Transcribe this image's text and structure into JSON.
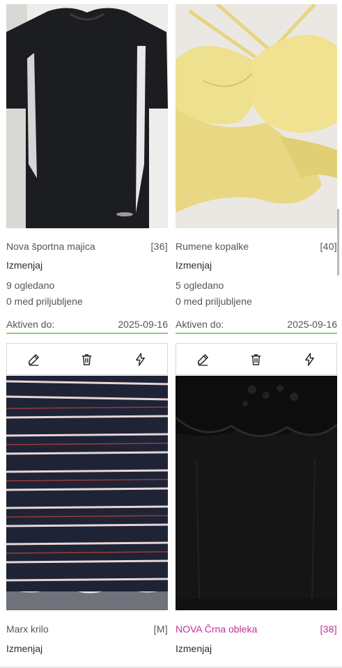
{
  "listings": [
    {
      "title": "Nova športna majica",
      "size": "[36]",
      "edit_label": "Izmenjaj",
      "views": "9 ogledano",
      "favorites": "0 med priljubljene",
      "active_label": "Aktiven do:",
      "active_date": "2025-09-16",
      "highlight": false,
      "image": "black-sport-shirt"
    },
    {
      "title": "Rumene kopalke",
      "size": "[40]",
      "edit_label": "Izmenjaj",
      "views": "5 ogledano",
      "favorites": "0 med priljubljene",
      "active_label": "Aktiven do:",
      "active_date": "2025-09-16",
      "highlight": false,
      "image": "yellow-swimsuit"
    },
    {
      "title": "Marx krilo",
      "size": "[M]",
      "edit_label": "Izmenjaj",
      "highlight": false,
      "image": "striped-skirt"
    },
    {
      "title": "NOVA Črna obleka",
      "size": "[38]",
      "edit_label": "Izmenjaj",
      "highlight": true,
      "highlight_color": "#c0309a",
      "image": "black-dress"
    }
  ],
  "actions": [
    "edit-icon",
    "trash-icon",
    "bolt-icon"
  ],
  "colors": {
    "active_underline": "#8fce79",
    "accent": "#c0309a"
  }
}
